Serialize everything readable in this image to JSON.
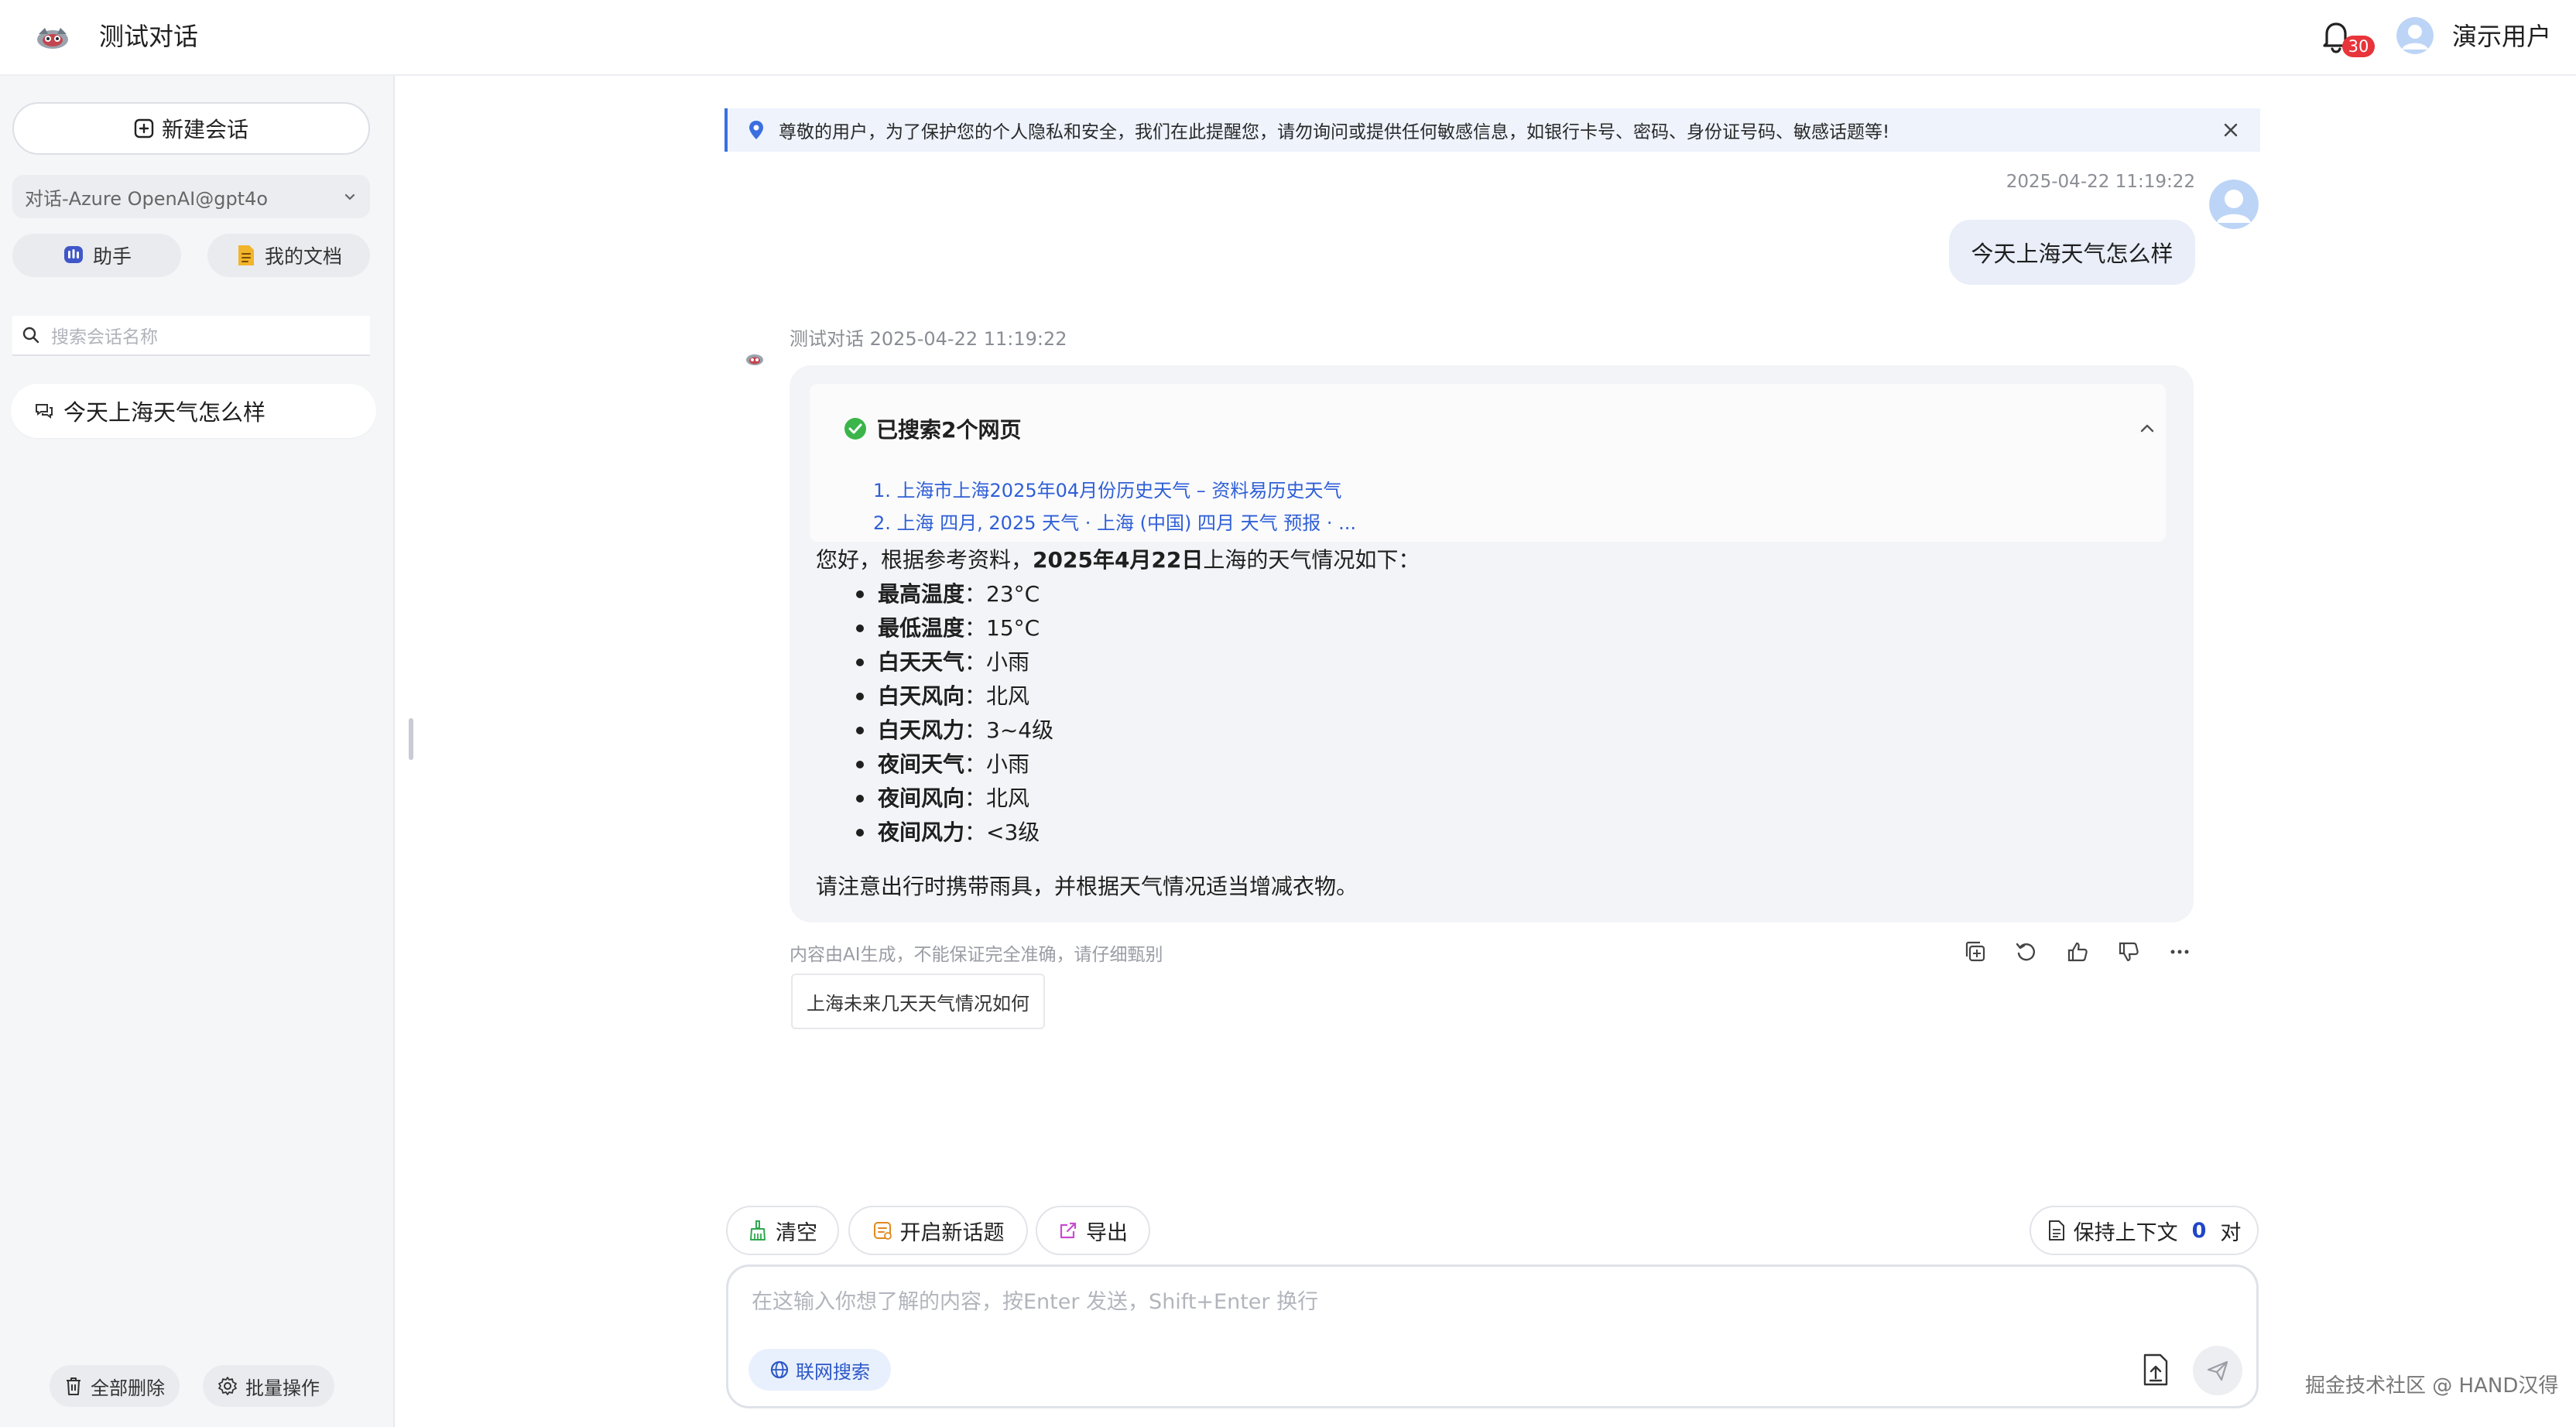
{
  "header": {
    "app_title": "测试对话",
    "notification_count": "30",
    "user_name": "演示用户"
  },
  "sidebar": {
    "new_chat_label": "新建会话",
    "model_select_value": "对话-Azure OpenAI@gpt4o",
    "assistant_label": "助手",
    "my_docs_label": "我的文档",
    "search_placeholder": "搜索会话名称",
    "conversations": [
      {
        "title": "今天上海天气怎么样"
      }
    ],
    "delete_all_label": "全部删除",
    "batch_ops_label": "批量操作"
  },
  "notice": {
    "text": "尊敬的用户，为了保护您的个人隐私和安全，我们在此提醒您，请勿询问或提供任何敏感信息，如银行卡号、密码、身份证号码、敏感话题等!"
  },
  "chat": {
    "user_message": {
      "time": "2025-04-22 11:19:22",
      "text": "今天上海天气怎么样"
    },
    "ai_message": {
      "meta": "测试对话 2025-04-22 11:19:22",
      "search_title": "已搜索2个网页",
      "search_results": [
        "1. 上海市上海2025年04月份历史天气 – 资料易历史天气",
        "2. 上海 四月, 2025 天气 · 上海 (中国) 四月 天气 预报 · ..."
      ],
      "intro_prefix": "您好，根据参考资料，",
      "intro_bold": "2025年4月22日",
      "intro_suffix": "上海的天气情况如下：",
      "weather": [
        {
          "key": "最高温度",
          "value": "：23°C"
        },
        {
          "key": "最低温度",
          "value": "：15°C"
        },
        {
          "key": "白天天气",
          "value": "：小雨"
        },
        {
          "key": "白天风向",
          "value": "：北风"
        },
        {
          "key": "白天风力",
          "value": "：3~4级"
        },
        {
          "key": "夜间天气",
          "value": "：小雨"
        },
        {
          "key": "夜间风向",
          "value": "：北风"
        },
        {
          "key": "夜间风力",
          "value": "：<3级"
        }
      ],
      "outro": "请注意出行时携带雨具，并根据天气情况适当增减衣物。",
      "disclaimer": "内容由AI生成，不能保证完全准确，请仔细甄别"
    },
    "suggestion": "上海未来几天天气情况如何"
  },
  "toolbar": {
    "clear_label": "清空",
    "new_topic_label": "开启新话题",
    "export_label": "导出",
    "context_prefix": "保持上下文",
    "context_count": "0",
    "context_suffix": "对"
  },
  "input": {
    "placeholder": "在这输入你想了解的内容，按Enter 发送，Shift+Enter 换行",
    "web_search_label": "联网搜索"
  },
  "watermark": "掘金技术社区 @ HAND汉得",
  "colors": {
    "accent": "#2f5fd6",
    "badge": "#e8343b",
    "success": "#3bb54a"
  }
}
